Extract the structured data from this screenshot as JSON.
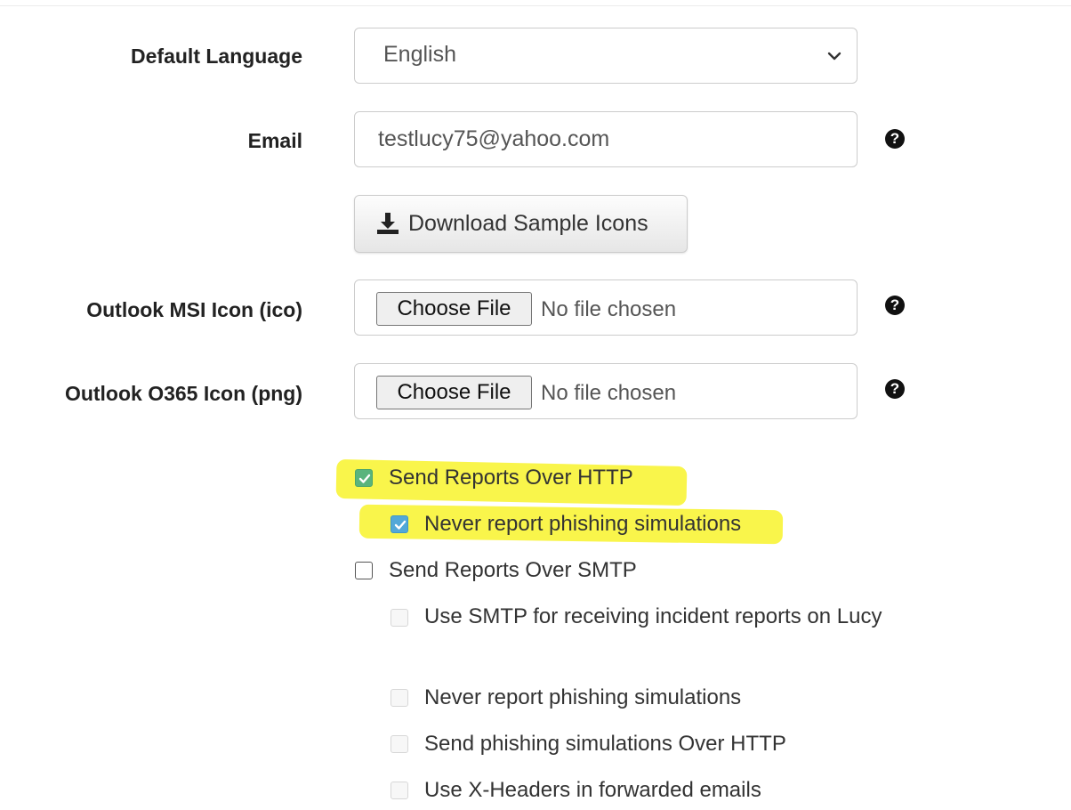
{
  "form": {
    "default_language": {
      "label": "Default Language",
      "selected": "English"
    },
    "email": {
      "label": "Email",
      "value": "testlucy75@yahoo.com",
      "help_icon": "question-circle-icon"
    },
    "download_button": {
      "label": "Download Sample Icons",
      "icon": "download-icon"
    },
    "outlook_msi_icon": {
      "label": "Outlook MSI Icon (ico)",
      "choose_label": "Choose File",
      "status": "No file chosen",
      "help_icon": "question-circle-icon"
    },
    "outlook_o365_icon": {
      "label": "Outlook O365 Icon (png)",
      "choose_label": "Choose File",
      "status": "No file chosen",
      "help_icon": "question-circle-icon"
    },
    "checkboxes": [
      {
        "label": "Send Reports Over HTTP",
        "checked": true,
        "disabled": false,
        "highlighted": true
      },
      {
        "label": "Never report phishing simulations",
        "checked": true,
        "disabled": false,
        "highlighted": true
      },
      {
        "label": "Send Reports Over SMTP",
        "checked": false,
        "disabled": false,
        "highlighted": false
      },
      {
        "label": "Use SMTP for receiving incident reports on Lucy",
        "checked": false,
        "disabled": true,
        "highlighted": false
      },
      {
        "label": "Never report phishing simulations",
        "checked": false,
        "disabled": true,
        "highlighted": false
      },
      {
        "label": "Send phishing simulations Over HTTP",
        "checked": false,
        "disabled": true,
        "highlighted": false
      },
      {
        "label": "Use X-Headers in forwarded emails",
        "checked": false,
        "disabled": true,
        "highlighted": false
      }
    ]
  },
  "colors": {
    "highlight": "#f8f32b",
    "checkbox_green": "#5ab47d",
    "checkbox_blue": "#52a8d8"
  }
}
